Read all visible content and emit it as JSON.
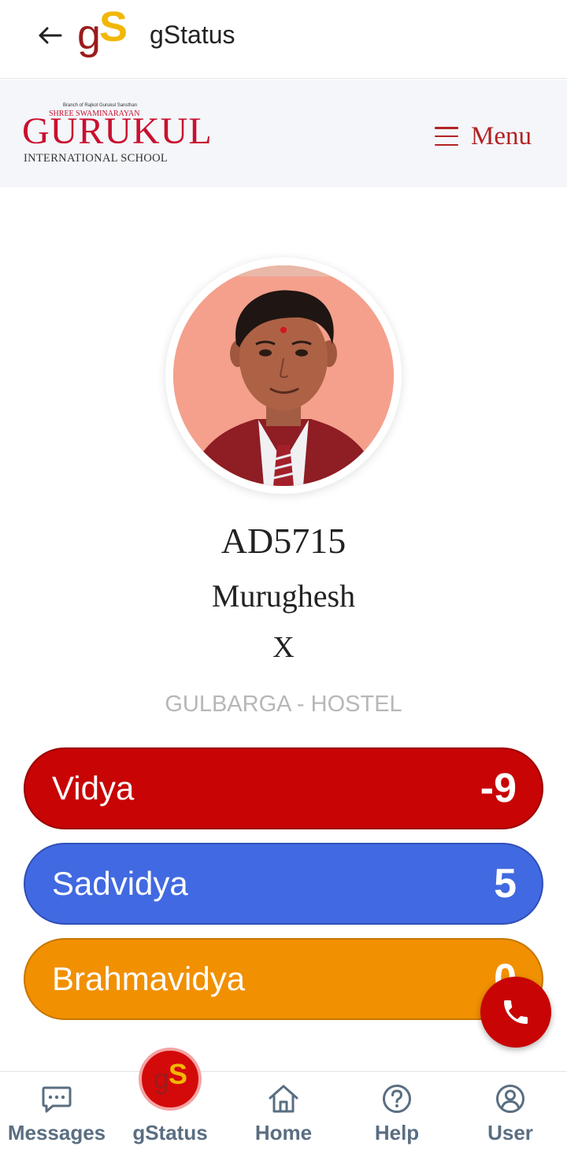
{
  "appbar": {
    "title": "gStatus",
    "logo_g": "g",
    "logo_s": "S"
  },
  "school": {
    "branch_line": "Branch of Rajkot Gurukul Sansthan",
    "shree_line": "SHREE SWAMINARAYAN",
    "name": "GURUKUL",
    "subtitle": "INTERNATIONAL SCHOOL",
    "menu_label": "Menu"
  },
  "student": {
    "id": "AD5715",
    "name": "Murughesh",
    "class": "X",
    "campus": "GULBARGA - HOSTEL"
  },
  "scores": [
    {
      "label": "Vidya",
      "value": "-9",
      "color": "#c80404"
    },
    {
      "label": "Sadvidya",
      "value": "5",
      "color": "#4169e1"
    },
    {
      "label": "Brahmavidya",
      "value": "0",
      "color": "#f19000"
    }
  ],
  "nav": {
    "items": [
      {
        "label": "Messages",
        "icon": "message-icon"
      },
      {
        "label": "gStatus",
        "icon": "gstatus-logo-icon",
        "active": true
      },
      {
        "label": "Home",
        "icon": "home-icon"
      },
      {
        "label": "Help",
        "icon": "help-icon"
      },
      {
        "label": "User",
        "icon": "user-icon"
      }
    ],
    "gs_g": "g",
    "gs_s": "S"
  }
}
